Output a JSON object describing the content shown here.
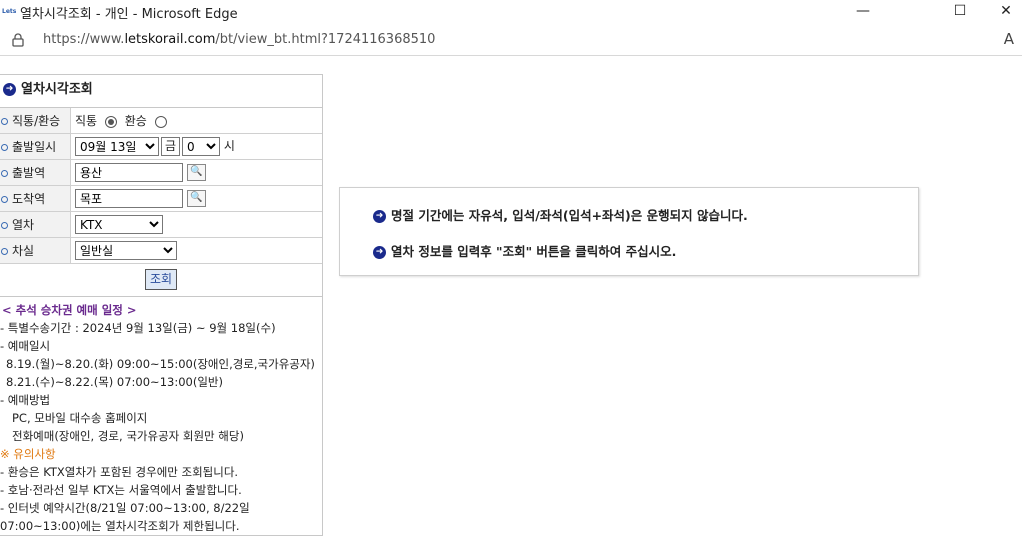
{
  "window": {
    "logo_text": "Lets",
    "title": "열차시각조회 - 개인 - Microsoft Edge",
    "minimize": "—",
    "maximize": "☐",
    "close": "✕"
  },
  "address": {
    "url_prefix": "https://www.",
    "url_domain": "letskorail.com",
    "url_path": "/bt/view_bt.html?1724116368510",
    "read_aloud": "A"
  },
  "panel": {
    "title": "열차시각조회",
    "rows": {
      "type_label": "직통/환승",
      "direct_label": "직통",
      "transfer_label": "환승",
      "date_label": "출발일시",
      "date_value": "09월 13일",
      "weekday": "금",
      "hour_value": "0",
      "hour_unit": "시",
      "dep_label": "출발역",
      "dep_value": "용산",
      "arr_label": "도착역",
      "arr_value": "목포",
      "train_label": "열차",
      "train_value": "KTX",
      "seat_label": "차실",
      "seat_value": "일반실"
    },
    "query_button": "조회",
    "notice": {
      "heading": "< 추석 승차권 예매 일정 >",
      "lines": [
        "- 특별수송기간 : 2024년 9월 13일(금) ~ 9월 18일(수)",
        "- 예매일시",
        " 8.19.(월)~8.20.(화) 09:00~15:00(장애인,경로,국가유공자)",
        " 8.21.(수)~8.22.(목) 07:00~13:00(일반)",
        "- 예매방법",
        "  PC, 모바일 대수송 홈페이지",
        "  전화예매(장애인, 경로, 국가유공자 회원만 해당)"
      ],
      "caution": "※ 유의사항",
      "caution_lines": [
        "- 환승은 KTX열차가 포함된 경우에만 조회됩니다.",
        "- 호남·전라선 일부 KTX는 서울역에서 출발합니다.",
        "- 인터넷 예약시간(8/21일 07:00~13:00, 8/22일",
        "07:00~13:00)에는 열차시각조회가 제한됩니다."
      ]
    }
  },
  "info": {
    "line1": "명절 기간에는 자유석, 입석/좌석(입석+좌석)은 운행되지 않습니다.",
    "line2": "열차 정보를 입력후 \"조회\" 버튼을 클릭하여 주십시오."
  },
  "colors": {
    "arrow_icon": "#1a2a8c",
    "notice_heading": "#6a2a8e",
    "caution": "#e07a12"
  }
}
